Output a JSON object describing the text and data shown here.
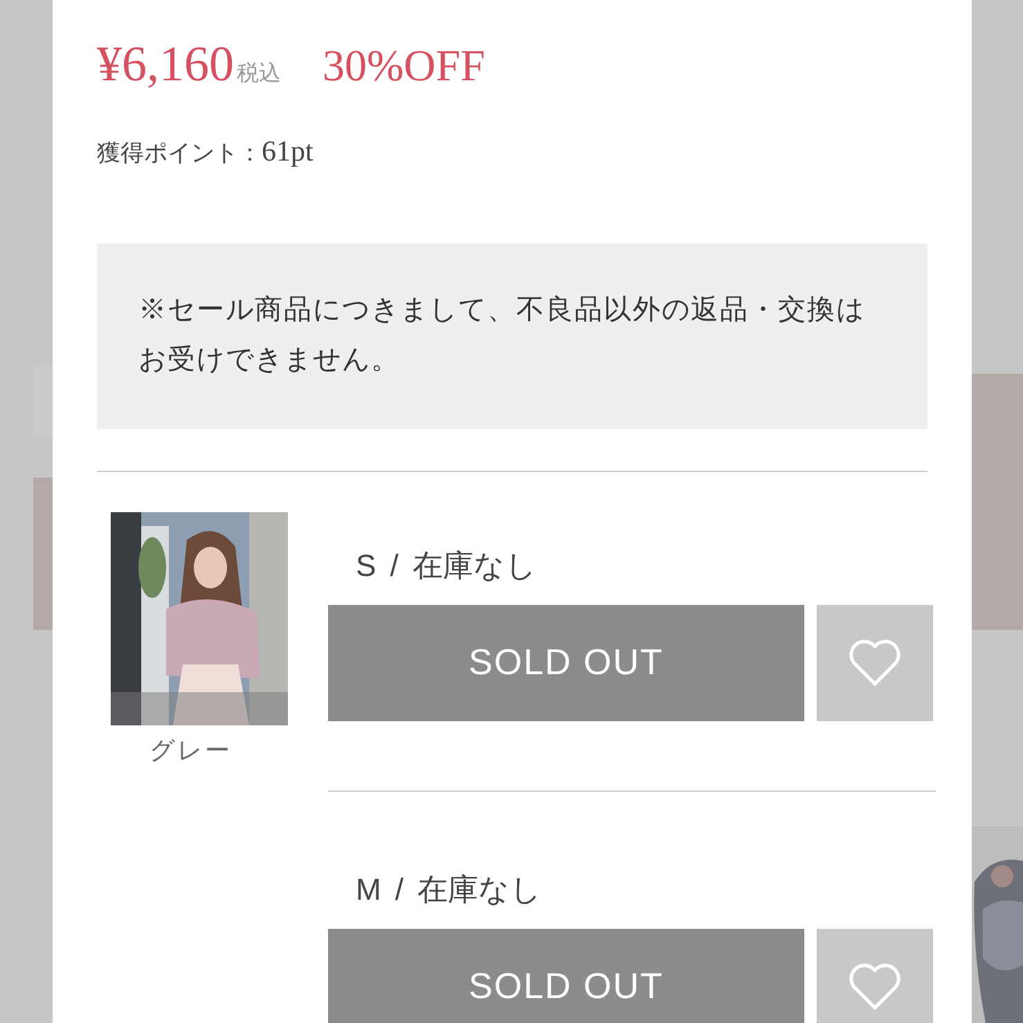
{
  "price": {
    "amount": "¥6,160",
    "tax": "税込",
    "discount": "30%OFF"
  },
  "points": {
    "label": "獲得ポイント：",
    "value": "61pt"
  },
  "notice": "※セール商品につきまして、不良品以外の返品・交換はお受けできません。",
  "variant": {
    "color_name": "グレー",
    "sizes": [
      {
        "label": "S",
        "separator": "/",
        "stock": "在庫なし",
        "button": "SOLD OUT",
        "sold_out": true,
        "favorited": false
      },
      {
        "label": "M",
        "separator": "/",
        "stock": "在庫なし",
        "button": "SOLD OUT",
        "sold_out": true,
        "favorited": false
      }
    ]
  }
}
